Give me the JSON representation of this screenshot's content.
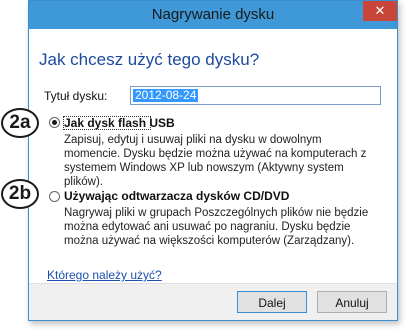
{
  "window": {
    "title": "Nagrywanie dysku",
    "close_symbol": "✕"
  },
  "heading": "Jak chcesz użyć tego dysku?",
  "disc_name": {
    "label": "Tytuł dysku:",
    "value": "2012-08-24"
  },
  "options": [
    {
      "title": "Jak dysk flash USB",
      "selected": true,
      "description": "Zapisuj, edytuj i usuwaj pliki na dysku w dowolnym momencie. Dysku będzie można używać na komputerach z systemem Windows XP lub nowszym (Aktywny system plików)."
    },
    {
      "title": "Używając odtwarzacza dysków CD/DVD",
      "selected": false,
      "description": "Nagrywaj pliki w grupach Poszczególnych plików nie będzie można edytować ani usuwać po nagraniu. Dysku będzie można używać na większości komputerów (Zarządzany)."
    }
  ],
  "help_link": "Którego należy użyć?",
  "buttons": {
    "next": "Dalej",
    "cancel": "Anuluj"
  },
  "callouts": [
    "2a",
    "2b"
  ],
  "colors": {
    "titlebar": "#3f98d8",
    "close_button": "#c9453a",
    "heading": "#1c4a9e",
    "link": "#1c4fb0",
    "selection": "#3399ff"
  }
}
